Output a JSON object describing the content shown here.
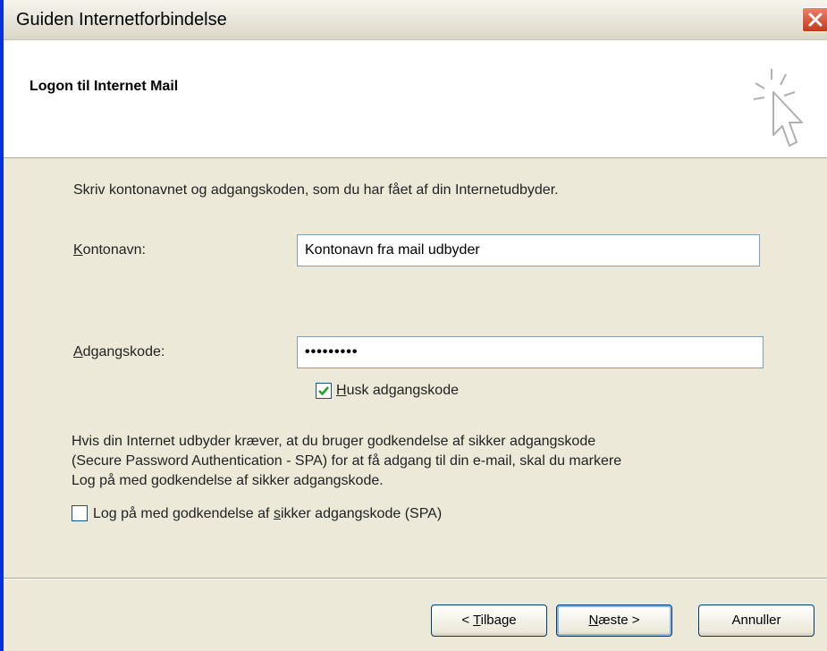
{
  "window": {
    "title": "Guiden Internetforbindelse",
    "close_icon": "close-icon"
  },
  "header": {
    "title": "Logon til Internet Mail",
    "icon": "wizard-cursor-icon"
  },
  "main": {
    "intro": "Skriv kontonavnet og adgangskoden, som du har fået af din Internetudbyder.",
    "account_label_ul": "K",
    "account_label_rest": "ontonavn:",
    "account_value": "Kontonavn fra mail udbyder",
    "password_label_ul": "A",
    "password_label_rest": "dgangskode:",
    "password_value": "•••••••••",
    "remember_ul": "H",
    "remember_rest": "usk adgangskode",
    "remember_checked": true,
    "spa_line1": "Hvis din Internet udbyder kræver, at du bruger godkendelse af sikker adgangskode",
    "spa_line2": "(Secure Password Authentication - SPA) for at få adgang til din e-mail, skal du markere",
    "spa_line3": "Log på med godkendelse af sikker adgangskode.",
    "spa_check_pre": "Log på med godkendelse af ",
    "spa_check_ul": "s",
    "spa_check_post": "ikker adgangskode (SPA)",
    "spa_checked": false
  },
  "buttons": {
    "back_pre": "< ",
    "back_ul": "T",
    "back_rest": "ilbage",
    "next_ul": "N",
    "next_rest": "æste >",
    "cancel": "Annuller"
  },
  "colors": {
    "accent": "#0831d9",
    "check": "#21a121"
  }
}
